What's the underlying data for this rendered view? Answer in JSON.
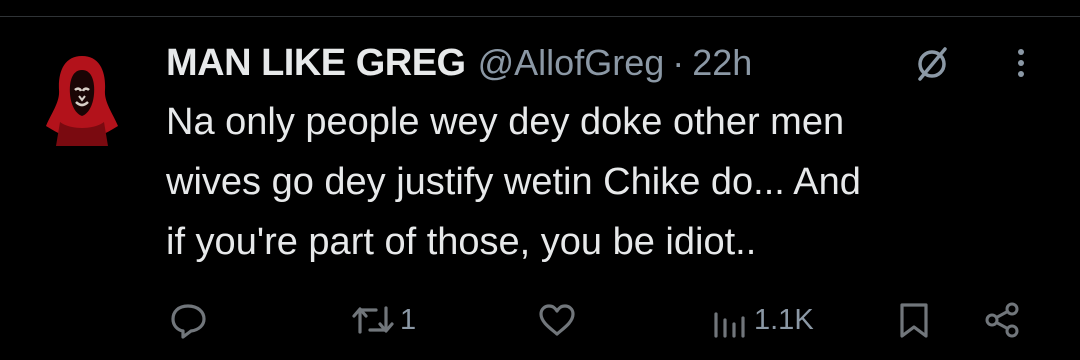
{
  "tweet": {
    "display_name": "MAN LIKE GREG",
    "handle": "@AllofGreg",
    "separator": "·",
    "timestamp": "22h",
    "text_lines": [
      "Na only people wey dey doke other men",
      "wives go dey justify wetin Chike do... And",
      "if you're part of those, you be idiot.."
    ]
  },
  "actions": {
    "reply": {
      "icon": "reply-icon",
      "count": ""
    },
    "retweet": {
      "icon": "retweet-icon",
      "count": "1"
    },
    "like": {
      "icon": "like-icon",
      "count": ""
    },
    "views": {
      "icon": "views-icon",
      "count": "1.1K"
    },
    "bookmark": {
      "icon": "bookmark-icon"
    },
    "share": {
      "icon": "share-icon"
    }
  },
  "colors": {
    "background": "#000000",
    "text_primary": "#e7e9ea",
    "text_secondary": "#8b98a5",
    "icon_gray": "#71767b",
    "avatar_red": "#b3121b"
  }
}
